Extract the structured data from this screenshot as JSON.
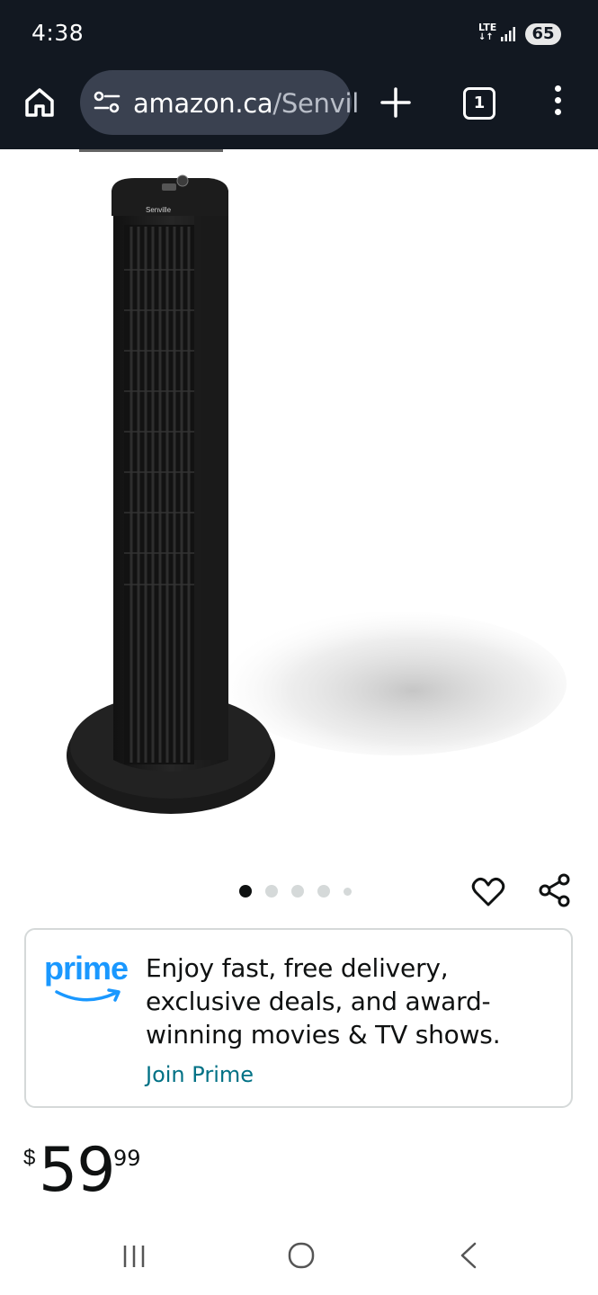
{
  "status_bar": {
    "time": "4:38",
    "network": "LTE",
    "battery": "65"
  },
  "browser": {
    "url_domain": "amazon.ca",
    "url_path": "/Senvil",
    "tab_count": "1",
    "icons": [
      "home-icon",
      "site-settings-icon",
      "plus-icon",
      "tab-switcher-icon",
      "more-vert-icon"
    ]
  },
  "product": {
    "image_icon": "tower-fan-image",
    "brand_mark": "Senville",
    "carousel": {
      "total": 5,
      "active_index": 0
    },
    "actions": [
      "heart-icon",
      "share-icon"
    ]
  },
  "prime_banner": {
    "logo_text": "prime",
    "message": "Enjoy fast, free delivery, exclusive deals, and award-winning movies & TV shows.",
    "link_label": "Join Prime",
    "logo_color": "#1a98ff",
    "link_color": "#007185"
  },
  "price": {
    "symbol": "$",
    "whole": "59",
    "fraction": "99"
  },
  "system_nav": {
    "icons": [
      "recent-apps-icon",
      "home-circle-icon",
      "back-icon"
    ]
  }
}
